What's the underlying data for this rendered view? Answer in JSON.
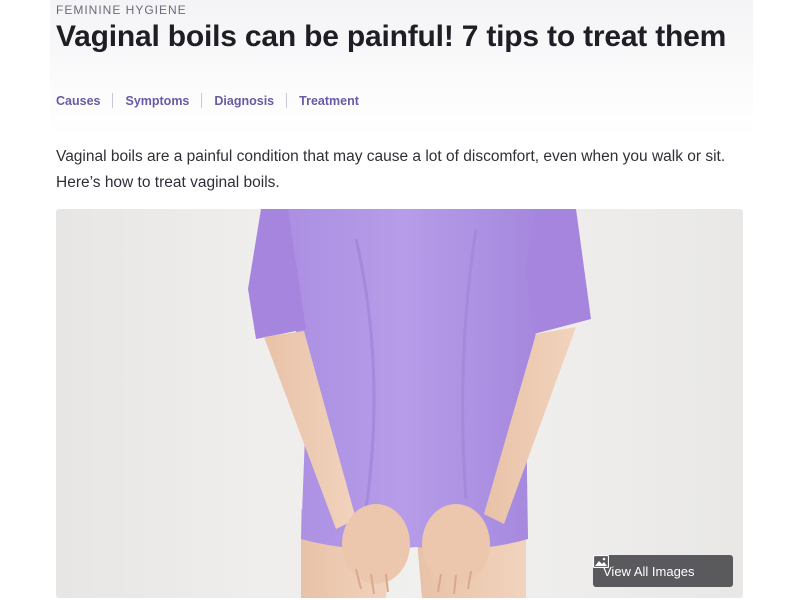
{
  "article": {
    "category": "FEMININE HYGIENE",
    "title": "Vaginal boils can be painful! 7 tips to treat them",
    "intro": "Vaginal boils are a painful condition that may cause a lot of discomfort, even when you walk or sit. Here’s how to treat vaginal boils."
  },
  "toc": {
    "items": [
      {
        "label": "Causes"
      },
      {
        "label": "Symptoms"
      },
      {
        "label": "Diagnosis"
      },
      {
        "label": "Treatment"
      }
    ]
  },
  "hero": {
    "view_all_label": "View All Images",
    "icon": "image-icon"
  },
  "colors": {
    "accent": "#6a5aa6",
    "title": "#1e1e24",
    "shirt": "#b196e6"
  }
}
